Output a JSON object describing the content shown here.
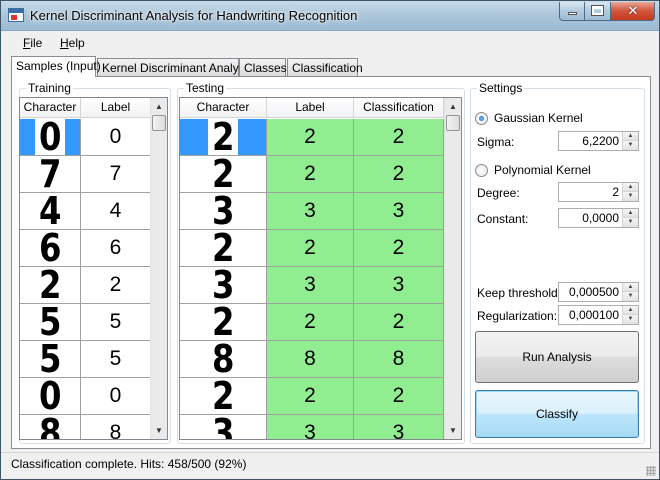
{
  "window": {
    "title": "Kernel Discriminant Analysis for Handwriting Recognition",
    "close_glyph": "✕"
  },
  "menu": {
    "file": "File",
    "help": "Help"
  },
  "tabs": [
    {
      "label": "Samples (Input)",
      "active": true
    },
    {
      "label": "Kernel Discriminant Analysis",
      "active": false
    },
    {
      "label": "Classes",
      "active": false
    },
    {
      "label": "Classification",
      "active": false
    }
  ],
  "training": {
    "title": "Training",
    "columns": [
      "Character",
      "Label"
    ],
    "rows": [
      {
        "character": "0",
        "label": "0",
        "selected": true
      },
      {
        "character": "7",
        "label": "7"
      },
      {
        "character": "4",
        "label": "4"
      },
      {
        "character": "6",
        "label": "6"
      },
      {
        "character": "2",
        "label": "2"
      },
      {
        "character": "5",
        "label": "5"
      },
      {
        "character": "5",
        "label": "5"
      },
      {
        "character": "0",
        "label": "0"
      },
      {
        "character": "8",
        "label": "8"
      }
    ]
  },
  "testing": {
    "title": "Testing",
    "columns": [
      "Character",
      "Label",
      "Classification"
    ],
    "rows": [
      {
        "character": "2",
        "label": "2",
        "classification": "2",
        "selected": true
      },
      {
        "character": "2",
        "label": "2",
        "classification": "2"
      },
      {
        "character": "3",
        "label": "3",
        "classification": "3"
      },
      {
        "character": "2",
        "label": "2",
        "classification": "2"
      },
      {
        "character": "3",
        "label": "3",
        "classification": "3"
      },
      {
        "character": "2",
        "label": "2",
        "classification": "2"
      },
      {
        "character": "8",
        "label": "8",
        "classification": "8"
      },
      {
        "character": "2",
        "label": "2",
        "classification": "2"
      },
      {
        "character": "3",
        "label": "3",
        "classification": "3"
      }
    ],
    "match_color": "#90ee90"
  },
  "settings": {
    "title": "Settings",
    "gaussian_label": "Gaussian Kernel",
    "gaussian_selected": true,
    "sigma_label": "Sigma:",
    "sigma_value": "6,2200",
    "polynomial_label": "Polynomial Kernel",
    "polynomial_selected": false,
    "degree_label": "Degree:",
    "degree_value": "2",
    "constant_label": "Constant:",
    "constant_value": "0,0000",
    "keep_threshold_label": "Keep threshold:",
    "keep_threshold_value": "0,000500",
    "regularization_label": "Regularization:",
    "regularization_value": "0,000100",
    "run_button": "Run Analysis",
    "classify_button": "Classify"
  },
  "status": "Classification complete. Hits: 458/500 (92%)",
  "colors": {
    "selection": "#3399ff",
    "match": "#90ee90"
  }
}
